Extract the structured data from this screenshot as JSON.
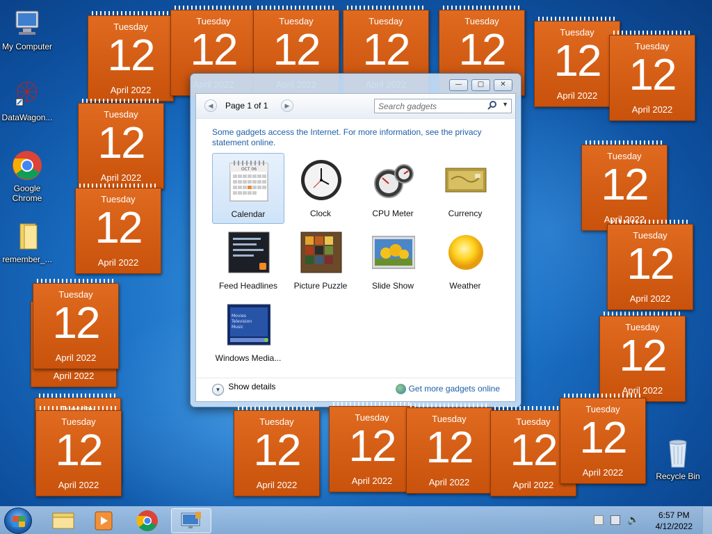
{
  "desktop_icons": [
    {
      "label": "My Computer"
    },
    {
      "label": "DataWagon..."
    },
    {
      "label": "Google Chrome"
    },
    {
      "label": "remember_..."
    },
    {
      "label": "Recycle Bin"
    }
  ],
  "calendar_gadget": {
    "day": "Tuesday",
    "date": "12",
    "month": "April 2022"
  },
  "gadget_window": {
    "pager": "Page 1 of 1",
    "search_placeholder": "Search gadgets",
    "notice": "Some gadgets access the Internet.  For more information, see the privacy statement online.",
    "gadgets": [
      {
        "label": "Calendar",
        "icon": "calendar-icon"
      },
      {
        "label": "Clock",
        "icon": "clock-icon"
      },
      {
        "label": "CPU Meter",
        "icon": "cpu-meter-icon"
      },
      {
        "label": "Currency",
        "icon": "currency-icon"
      },
      {
        "label": "Feed Headlines",
        "icon": "feed-headlines-icon"
      },
      {
        "label": "Picture Puzzle",
        "icon": "picture-puzzle-icon"
      },
      {
        "label": "Slide Show",
        "icon": "slide-show-icon"
      },
      {
        "label": "Weather",
        "icon": "weather-icon"
      },
      {
        "label": "Windows Media...",
        "icon": "windows-media-icon"
      }
    ],
    "calendar_thumb_month": "OCT 06",
    "media_thumb_lines": [
      "Movies",
      "Television",
      "Music"
    ],
    "show_details": "Show details",
    "get_more": "Get more gadgets online"
  },
  "taskbar": {
    "time": "6:57 PM",
    "date": "4/12/2022"
  },
  "colors": {
    "calendar_orange": "#d65d14",
    "link_blue": "#1e5fa6"
  }
}
